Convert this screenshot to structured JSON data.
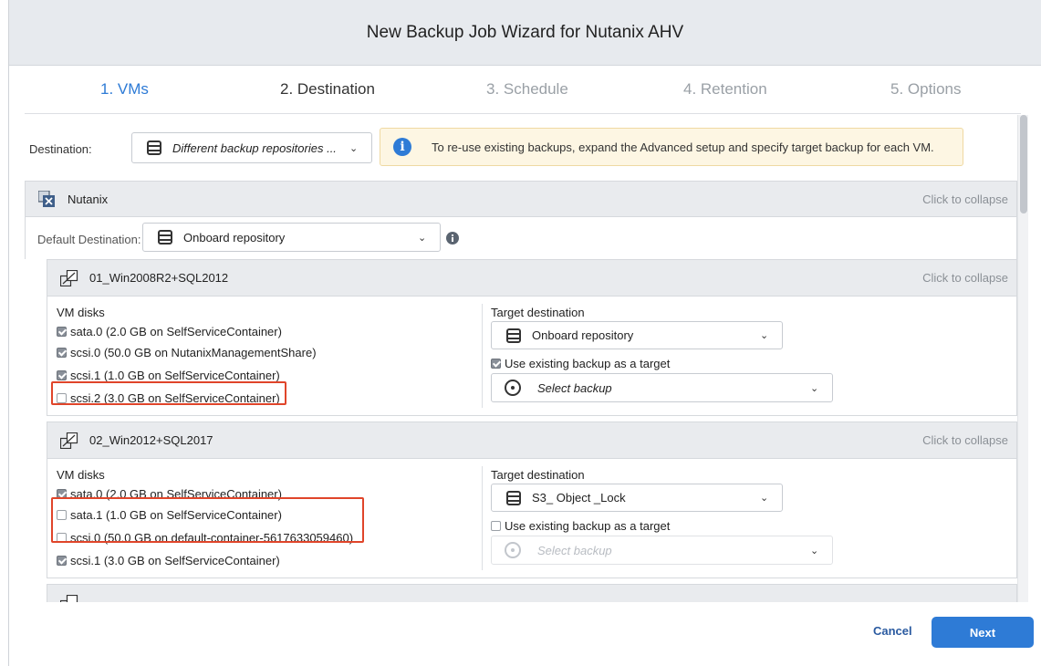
{
  "window": {
    "title": "New Backup Job Wizard for Nutanix AHV"
  },
  "steps": [
    "1. VMs",
    "2. Destination",
    "3. Schedule",
    "4. Retention",
    "5. Options"
  ],
  "destination": {
    "label": "Destination:",
    "value": "Different backup repositories ...",
    "info": "To re-use existing backups, expand the Advanced setup and specify target backup for each VM."
  },
  "cluster": {
    "name": "Nutanix",
    "collapse": "Click to collapse",
    "default_destination_label": "Default Destination:",
    "default_destination_value": "Onboard repository"
  },
  "vms": [
    {
      "name": "01_Win2008R2+SQL2012",
      "collapse": "Click to collapse",
      "disks_title": "VM disks",
      "disks": [
        {
          "label": "sata.0 (2.0 GB on SelfServiceContainer)",
          "checked": true
        },
        {
          "label": "scsi.0 (50.0 GB on NutanixManagementShare)",
          "checked": true
        },
        {
          "label": "scsi.1 (1.0 GB on SelfServiceContainer)",
          "checked": true
        },
        {
          "label": "scsi.2 (3.0 GB on SelfServiceContainer)",
          "checked": false
        }
      ],
      "target_title": "Target destination",
      "target_value": "Onboard repository",
      "use_existing_label": "Use existing backup as a target",
      "use_existing_checked": true,
      "select_backup": "Select backup"
    },
    {
      "name": "02_Win2012+SQL2017",
      "collapse": "Click to collapse",
      "disks_title": "VM disks",
      "disks": [
        {
          "label": "sata.0 (2.0 GB on SelfServiceContainer)",
          "checked": true
        },
        {
          "label": "sata.1 (1.0 GB on SelfServiceContainer)",
          "checked": false
        },
        {
          "label": "scsi.0 (50.0 GB on default-container-5617633059460)",
          "checked": false
        },
        {
          "label": "scsi.1 (3.0 GB on SelfServiceContainer)",
          "checked": true
        }
      ],
      "target_title": "Target destination",
      "target_value": "S3_ Object _Lock",
      "use_existing_label": "Use existing backup as a target",
      "use_existing_checked": false,
      "select_backup": "Select backup"
    }
  ],
  "footer": {
    "cancel": "Cancel",
    "next": "Next"
  },
  "colors": {
    "accent": "#2e7bd6",
    "highlight": "#e0452a",
    "banner_bg": "#fdf6e3"
  },
  "icons": [
    "repository-icon",
    "info-icon",
    "chevron-down-icon",
    "nutanix-cluster-icon",
    "vm-icon",
    "select-backup-icon"
  ]
}
